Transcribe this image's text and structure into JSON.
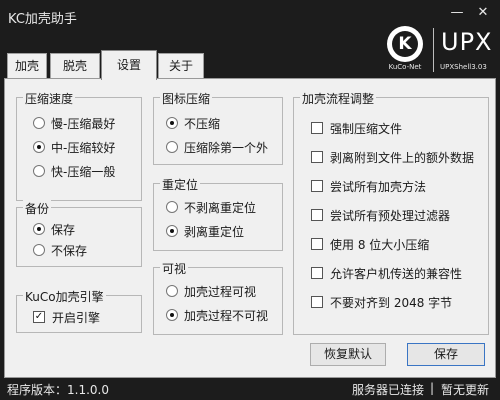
{
  "window": {
    "title": "KC加壳助手",
    "minimize": "—",
    "close": "✕"
  },
  "logo": {
    "letter": "K",
    "brand_left": "KuCo-Net",
    "brand_big": "UPX",
    "brand_right": "UPXShell3.03"
  },
  "tabs": [
    {
      "label": "加壳"
    },
    {
      "label": "脱壳"
    },
    {
      "label": "设置",
      "active": true
    },
    {
      "label": "关于"
    }
  ],
  "compression_speed": {
    "title": "压缩速度",
    "options": [
      "慢-压缩最好",
      "中-压缩较好",
      "快-压缩一般"
    ],
    "selected": 1
  },
  "icon_compress": {
    "title": "图标压缩",
    "options": [
      "不压缩",
      "压缩除第一个外"
    ],
    "selected": 0
  },
  "backup": {
    "title": "备份",
    "options": [
      "保存",
      "不保存"
    ],
    "selected": 0
  },
  "relocation": {
    "title": "重定位",
    "options": [
      "不剥离重定位",
      "剥离重定位"
    ],
    "selected": 1
  },
  "engine": {
    "title": "KuCo加壳引擎",
    "checkbox": "开启引擎",
    "checked": true
  },
  "visible": {
    "title": "可视",
    "options": [
      "加壳过程可视",
      "加壳过程不可视"
    ],
    "selected": 1
  },
  "process": {
    "title": "加壳流程调整",
    "items": [
      "强制压缩文件",
      "剥离附到文件上的额外数据",
      "尝试所有加壳方法",
      "尝试所有预处理过滤器",
      "使用 8 位大小压缩",
      "允许客户机传送的兼容性",
      "不要对齐到 2048 字节"
    ]
  },
  "buttons": {
    "restore": "恢复默认",
    "save": "保存"
  },
  "status": {
    "version": "程序版本：1.1.0.0",
    "server": "服务器已连接",
    "separator": "|",
    "update": "暂无更新"
  },
  "colors": {
    "chrome": "#1c1c1c",
    "panel": "#f0f0f0",
    "accent": "#3a75c4"
  }
}
